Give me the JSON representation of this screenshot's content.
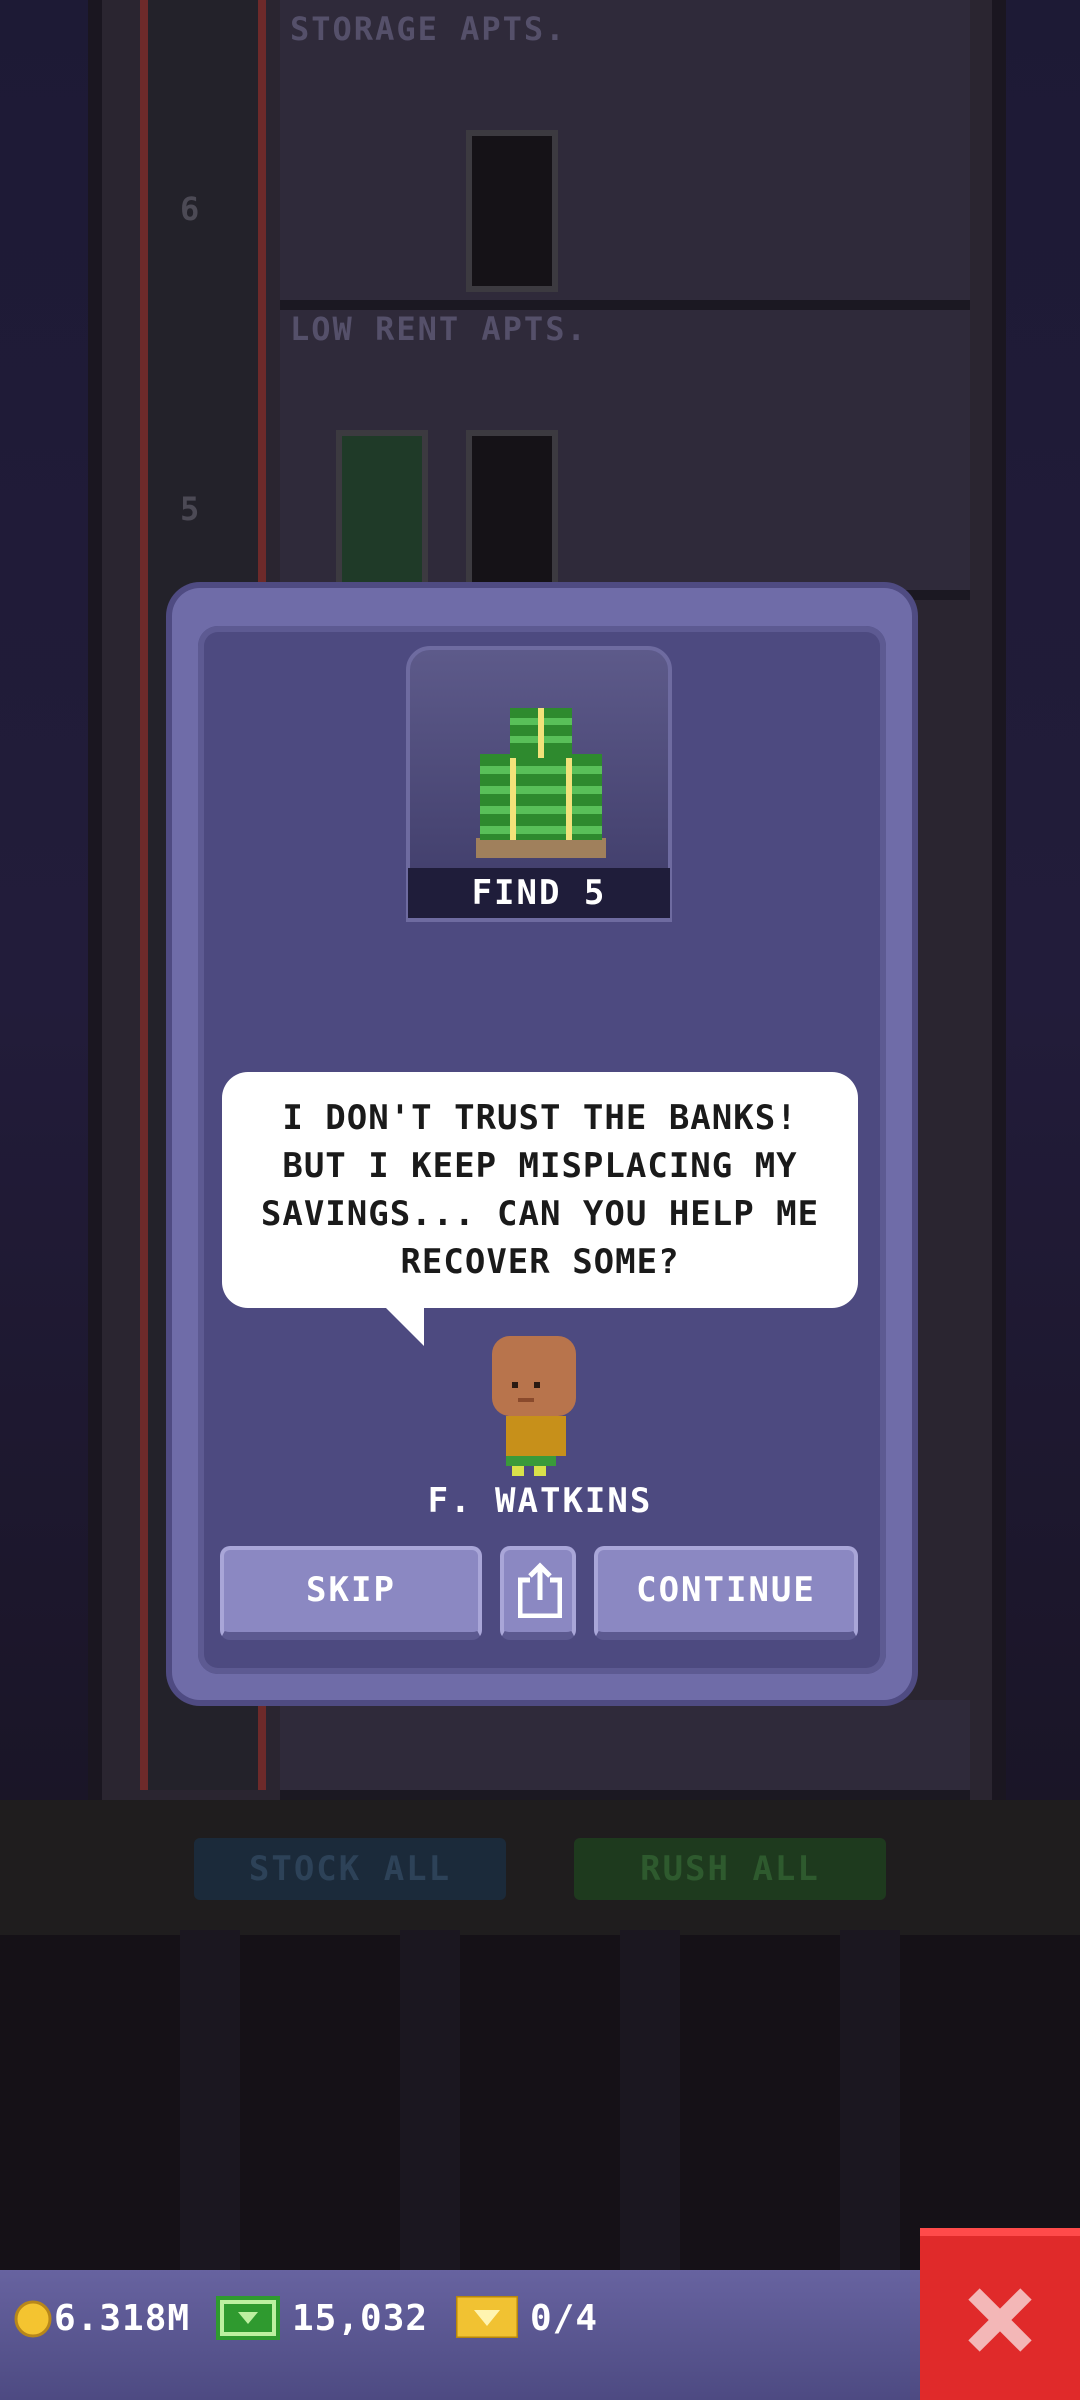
{
  "background": {
    "floors": [
      {
        "title": "STORAGE APTS.",
        "shaft_number": "6"
      },
      {
        "title": "LOW RENT APTS.",
        "shaft_number": "5"
      }
    ],
    "buttons": {
      "stock_all": "STOCK ALL",
      "rush_all": "RUSH ALL"
    }
  },
  "modal": {
    "quest": {
      "label": "FIND 5",
      "icon": "cash-stack-icon"
    },
    "speech": "I DON'T TRUST THE BANKS! BUT I KEEP MISPLACING MY SAVINGS... CAN YOU HELP ME RECOVER SOME?",
    "character_name": "F. WATKINS",
    "buttons": {
      "skip": "SKIP",
      "share_icon": "share-icon",
      "continue": "CONTINUE"
    }
  },
  "hud": {
    "coins": "6.318M",
    "bux": "15,032",
    "tickets": "0/4",
    "close_icon": "close-icon"
  },
  "colors": {
    "modal_bg": "#4d4a80",
    "modal_border": "#6f6ca8",
    "button": "#8b88c2",
    "close": "#e02a2a",
    "coin": "#f4c430",
    "bux": "#2f9a2f",
    "ticket": "#f1c232"
  }
}
